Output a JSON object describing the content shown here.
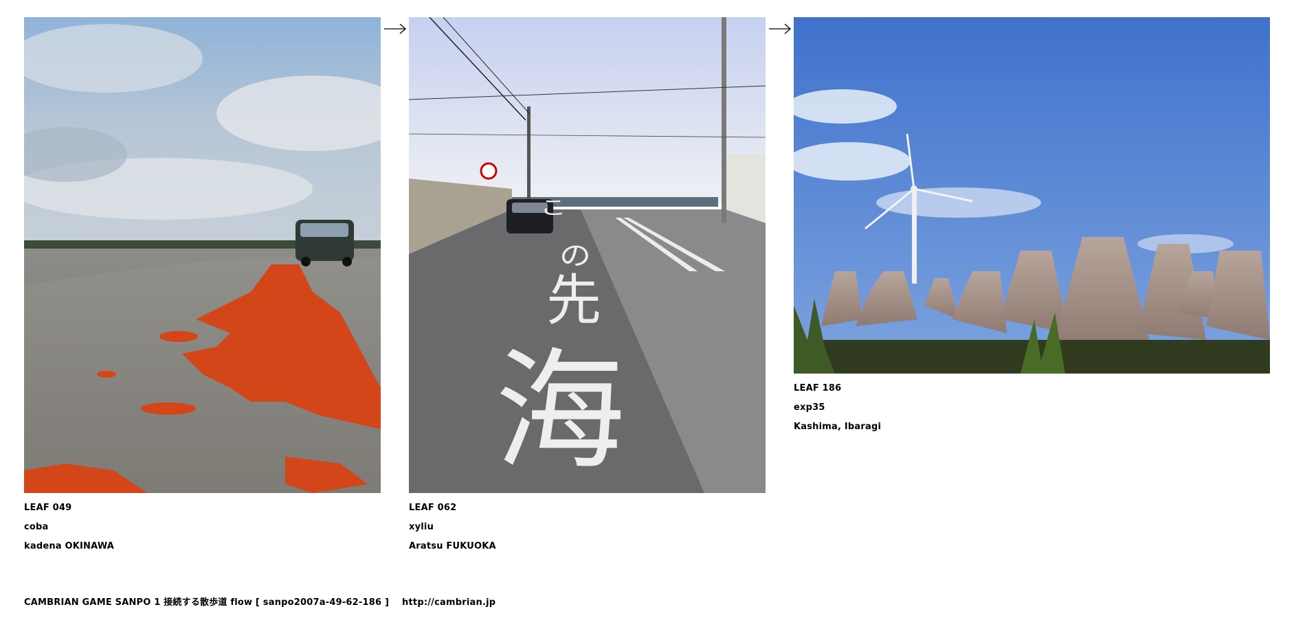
{
  "leaves": [
    {
      "leaf_id": "LEAF 049",
      "author": "coba",
      "location": "kadena OKINAWA",
      "photo_subject": "orange-painted road edge with car under cloudy sky"
    },
    {
      "leaf_id": "LEAF 062",
      "author": "xyliu",
      "location": "Aratsu FUKUOKA",
      "photo_subject": "road leading to the sea with painted characters",
      "road_text": [
        "こ",
        "の",
        "先",
        "海"
      ]
    },
    {
      "leaf_id": "LEAF 186",
      "author": "exp35",
      "location": "Kashima, Ibaragi",
      "photo_subject": "wind turbine behind concrete tetrapods"
    }
  ],
  "arrows": [
    "→",
    "→"
  ],
  "footer": {
    "text": "CAMBRIAN GAME  SANPO 1 接続する散歩道 flow [ sanpo2007a-49-62-186 ]",
    "url": "http://cambrian.jp"
  },
  "colors": {
    "sky_blue": "#4a7fd0",
    "road_orange": "#d2461a",
    "asphalt": "#5a5a5c"
  }
}
